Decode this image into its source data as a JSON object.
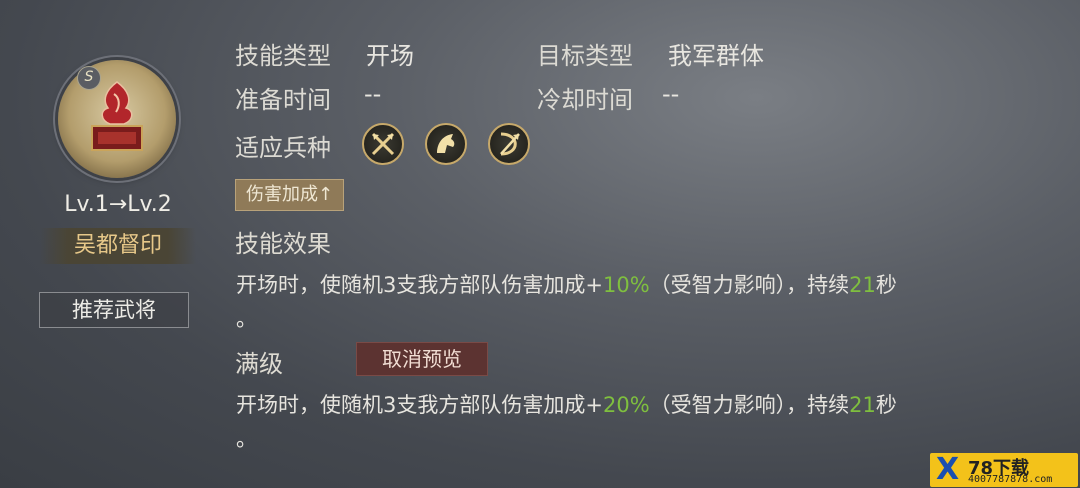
{
  "item": {
    "grade": "S",
    "level_text": "Lv.1→Lv.2",
    "name": "吴都督印",
    "recommend_label": "推荐武将"
  },
  "info": {
    "skill_type_label": "技能类型",
    "skill_type_value": "开场",
    "target_type_label": "目标类型",
    "target_type_value": "我军群体",
    "prep_time_label": "准备时间",
    "prep_time_value": "--",
    "cooldown_label": "冷却时间",
    "cooldown_value": "--",
    "troops_label": "适应兵种",
    "troop_icons": [
      "spear-infantry-icon",
      "cavalry-horse-icon",
      "archer-bow-icon"
    ]
  },
  "bonus_tag": "伤害加成↑",
  "effect": {
    "title": "技能效果",
    "prefix": "开场时，使随机3支我方部队伤害加成+",
    "value": "10%",
    "middle": "（受智力影响），持续",
    "duration": "21",
    "suffix": "秒",
    "end": "。"
  },
  "max_level": {
    "title": "满级",
    "cancel_preview_label": "取消预览",
    "prefix": "开场时，使随机3支我方部队伤害加成+",
    "value": "20%",
    "middle": "（受智力影响），持续",
    "duration": "21",
    "suffix": "秒",
    "end": "。"
  },
  "watermark": {
    "mark": "X",
    "main": "78下载",
    "sub": "4007787878.com"
  },
  "colors": {
    "highlight_green": "#7fbf3f",
    "gold_name": "#e7c889",
    "cancel_bg": "#5c3331",
    "watermark_bg": "#f3c21a"
  }
}
